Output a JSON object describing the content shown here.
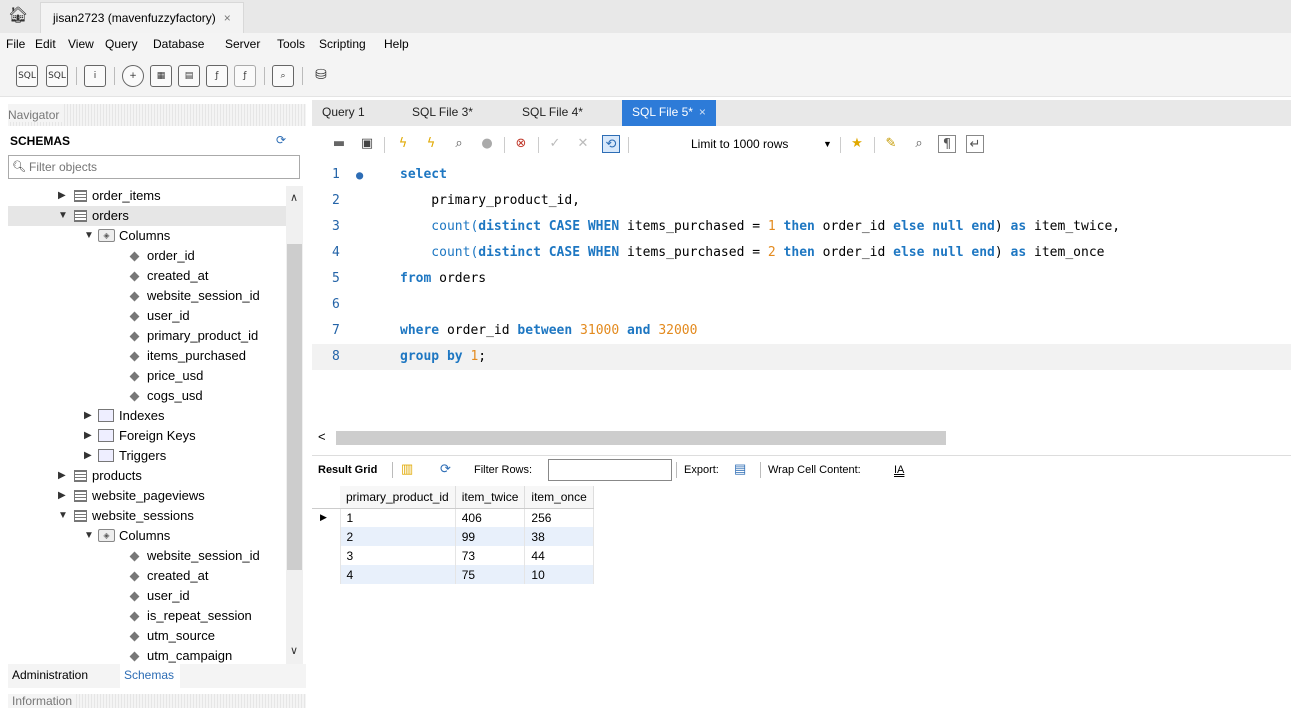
{
  "window": {
    "connection_tab": "jisan2723 (mavenfuzzyfactory)",
    "close_glyph": "×"
  },
  "menu": [
    "File",
    "Edit",
    "View",
    "Query",
    "Database",
    "Server",
    "Tools",
    "Scripting",
    "Help"
  ],
  "toolbar_icons": [
    "new-sql-tab-icon",
    "open-sql-script-icon",
    "schema-inspector-icon",
    "create-schema-icon",
    "create-table-icon",
    "create-view-icon",
    "create-procedure-icon",
    "create-function-icon",
    "search-table-data-icon",
    "reconnect-icon"
  ],
  "navigator": {
    "header": "Navigator",
    "schemas_title": "SCHEMAS",
    "filter_placeholder": "Filter objects",
    "tree": [
      {
        "label": "order_items",
        "type": "table",
        "expanded": false,
        "level": 1
      },
      {
        "label": "orders",
        "type": "table",
        "expanded": true,
        "level": 1,
        "selected": true
      },
      {
        "label": "Columns",
        "type": "columns-group",
        "expanded": true,
        "level": 2
      },
      {
        "label": "order_id",
        "type": "column",
        "level": 3
      },
      {
        "label": "created_at",
        "type": "column",
        "level": 3
      },
      {
        "label": "website_session_id",
        "type": "column",
        "level": 3
      },
      {
        "label": "user_id",
        "type": "column",
        "level": 3
      },
      {
        "label": "primary_product_id",
        "type": "column",
        "level": 3
      },
      {
        "label": "items_purchased",
        "type": "column",
        "level": 3
      },
      {
        "label": "price_usd",
        "type": "column",
        "level": 3
      },
      {
        "label": "cogs_usd",
        "type": "column",
        "level": 3
      },
      {
        "label": "Indexes",
        "type": "group",
        "expanded": false,
        "level": 2
      },
      {
        "label": "Foreign Keys",
        "type": "group",
        "expanded": false,
        "level": 2
      },
      {
        "label": "Triggers",
        "type": "group",
        "expanded": false,
        "level": 2
      },
      {
        "label": "products",
        "type": "table",
        "expanded": false,
        "level": 1
      },
      {
        "label": "website_pageviews",
        "type": "table",
        "expanded": false,
        "level": 1
      },
      {
        "label": "website_sessions",
        "type": "table",
        "expanded": true,
        "level": 1
      },
      {
        "label": "Columns",
        "type": "columns-group",
        "expanded": true,
        "level": 2
      },
      {
        "label": "website_session_id",
        "type": "column",
        "level": 3
      },
      {
        "label": "created_at",
        "type": "column",
        "level": 3
      },
      {
        "label": "user_id",
        "type": "column",
        "level": 3
      },
      {
        "label": "is_repeat_session",
        "type": "column",
        "level": 3
      },
      {
        "label": "utm_source",
        "type": "column",
        "level": 3
      },
      {
        "label": "utm_campaign",
        "type": "column",
        "level": 3
      }
    ],
    "bottom_tabs": {
      "administration": "Administration",
      "schemas": "Schemas"
    },
    "info_header": "Information"
  },
  "editor": {
    "tabs": [
      {
        "label": "Query 1",
        "active": false
      },
      {
        "label": "SQL File 3*",
        "active": false
      },
      {
        "label": "SQL File 4*",
        "active": false
      },
      {
        "label": "SQL File 5*",
        "active": true
      }
    ],
    "limit_rows": "Limit to 1000 rows",
    "lines": [
      {
        "n": "1",
        "tokens": [
          {
            "t": "select",
            "c": "kw"
          }
        ],
        "dot": true
      },
      {
        "n": "2",
        "tokens": [
          {
            "t": "    primary_product_id,",
            "c": "plain"
          }
        ]
      },
      {
        "n": "3",
        "tokens": [
          {
            "t": "    count(",
            "c": "fn"
          },
          {
            "t": "distinct CASE WHEN",
            "c": "kw"
          },
          {
            "t": " items_purchased = ",
            "c": "plain"
          },
          {
            "t": "1",
            "c": "num"
          },
          {
            "t": " then",
            "c": "kw"
          },
          {
            "t": " order_id ",
            "c": "plain"
          },
          {
            "t": "else null end",
            "c": "kw"
          },
          {
            "t": ") ",
            "c": "plain"
          },
          {
            "t": "as",
            "c": "kw"
          },
          {
            "t": " item_twice,",
            "c": "plain"
          }
        ]
      },
      {
        "n": "4",
        "tokens": [
          {
            "t": "    count(",
            "c": "fn"
          },
          {
            "t": "distinct CASE WHEN",
            "c": "kw"
          },
          {
            "t": " items_purchased = ",
            "c": "plain"
          },
          {
            "t": "2",
            "c": "num"
          },
          {
            "t": " then",
            "c": "kw"
          },
          {
            "t": " order_id ",
            "c": "plain"
          },
          {
            "t": "else null end",
            "c": "kw"
          },
          {
            "t": ") ",
            "c": "plain"
          },
          {
            "t": "as",
            "c": "kw"
          },
          {
            "t": " item_once",
            "c": "plain"
          }
        ]
      },
      {
        "n": "5",
        "tokens": [
          {
            "t": "from",
            "c": "kw"
          },
          {
            "t": " orders",
            "c": "plain"
          }
        ]
      },
      {
        "n": "6",
        "tokens": []
      },
      {
        "n": "7",
        "tokens": [
          {
            "t": "where",
            "c": "kw"
          },
          {
            "t": " order_id ",
            "c": "plain"
          },
          {
            "t": "between",
            "c": "kw"
          },
          {
            "t": " ",
            "c": "plain"
          },
          {
            "t": "31000",
            "c": "num"
          },
          {
            "t": " ",
            "c": "plain"
          },
          {
            "t": "and",
            "c": "kw"
          },
          {
            "t": " ",
            "c": "plain"
          },
          {
            "t": "32000",
            "c": "num"
          }
        ]
      },
      {
        "n": "8",
        "tokens": [
          {
            "t": "group by",
            "c": "kw"
          },
          {
            "t": " ",
            "c": "plain"
          },
          {
            "t": "1",
            "c": "num"
          },
          {
            "t": ";",
            "c": "plain"
          }
        ],
        "current": true
      }
    ]
  },
  "results": {
    "result_grid_label": "Result Grid",
    "filter_rows_label": "Filter Rows:",
    "filter_rows_value": "",
    "export_label": "Export:",
    "wrap_label": "Wrap Cell Content:",
    "columns": [
      "primary_product_id",
      "item_twice",
      "item_once"
    ],
    "rows": [
      [
        "1",
        "406",
        "256"
      ],
      [
        "2",
        "99",
        "38"
      ],
      [
        "3",
        "73",
        "44"
      ],
      [
        "4",
        "75",
        "10"
      ]
    ]
  }
}
